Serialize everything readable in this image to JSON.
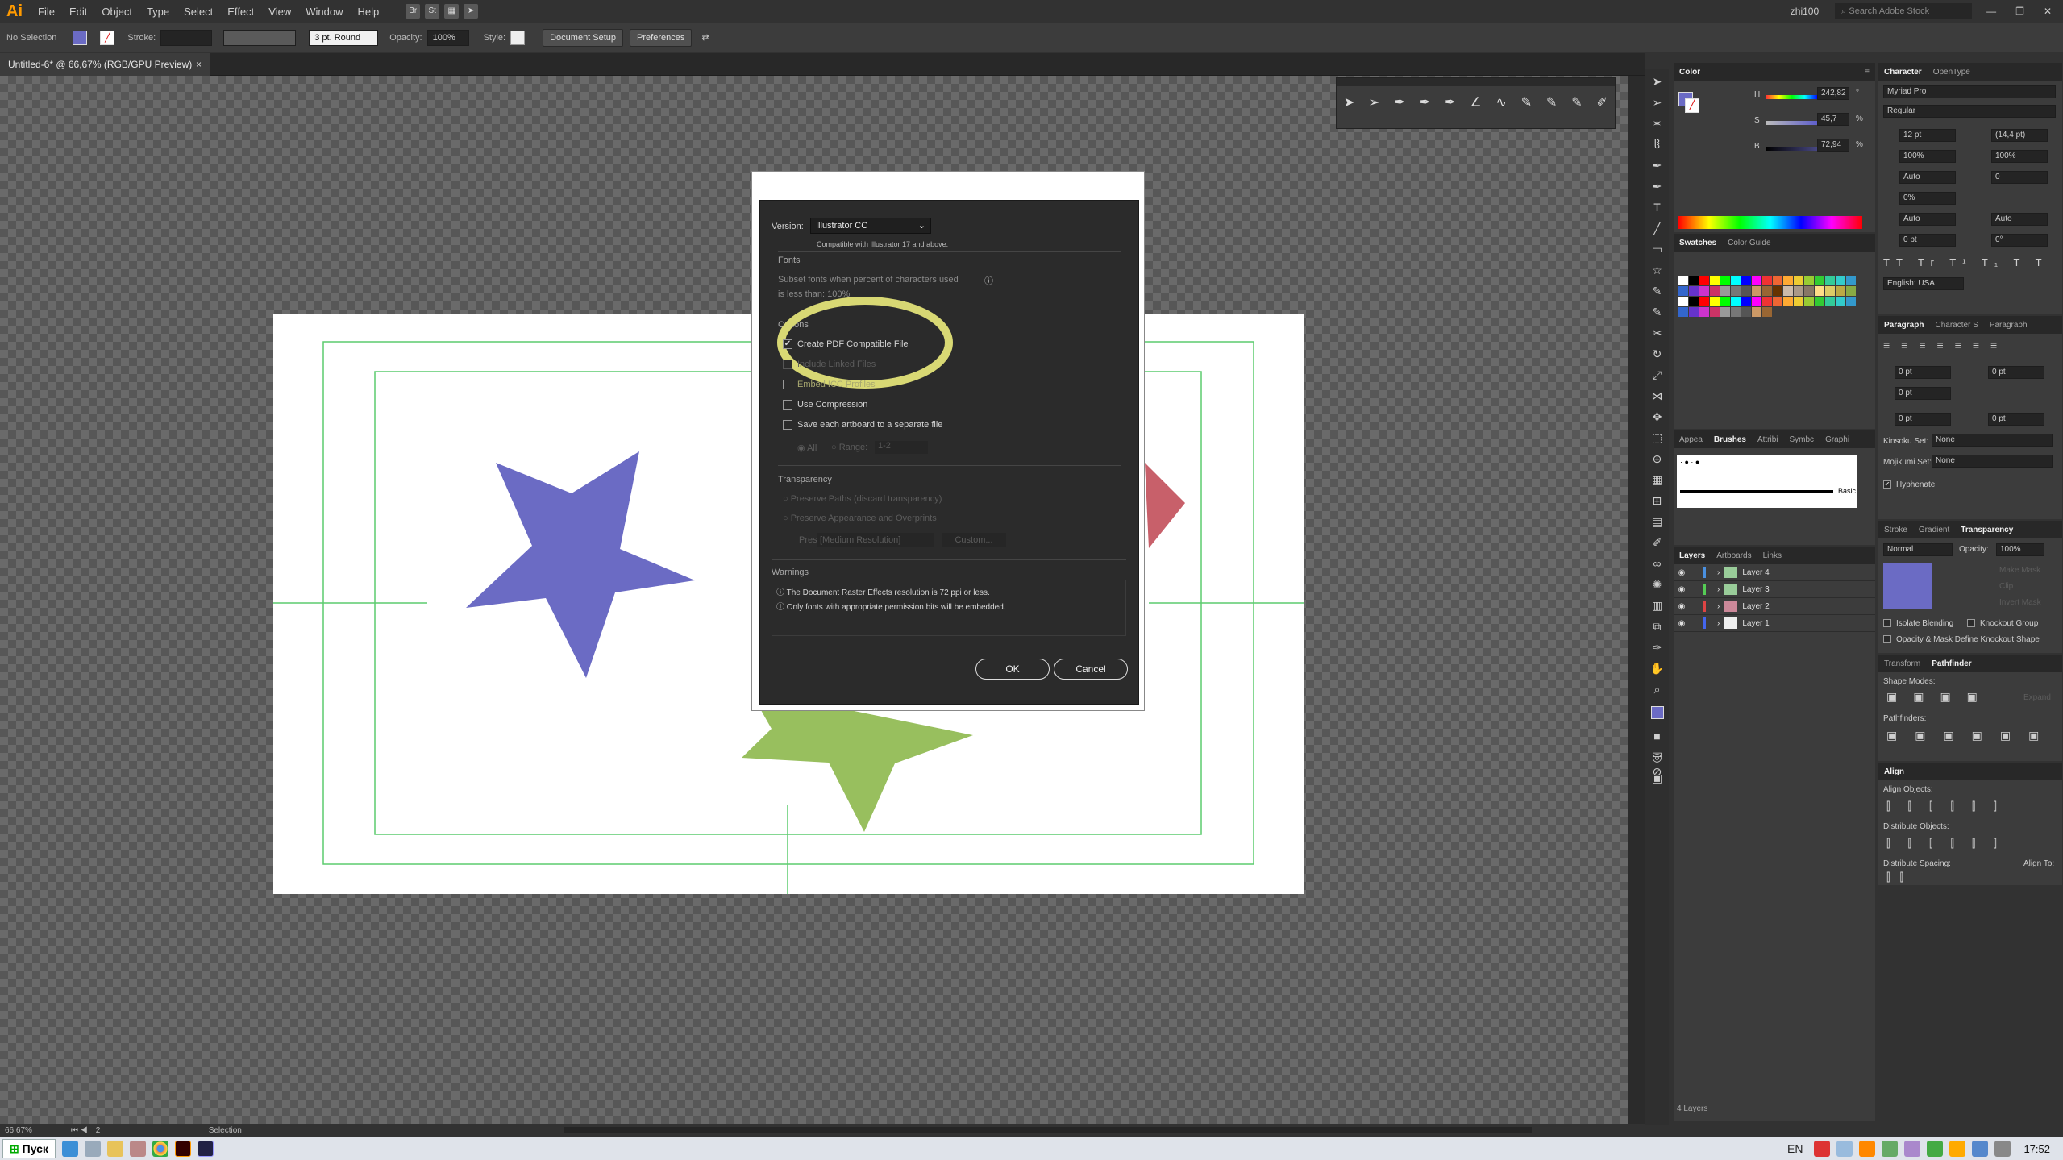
{
  "menubar": {
    "logo": "Ai",
    "items": [
      "File",
      "Edit",
      "Object",
      "Type",
      "Select",
      "Effect",
      "View",
      "Window",
      "Help"
    ],
    "br": "Br",
    "st": "St",
    "user": "zhi100",
    "search_placeholder": "Search Adobe Stock"
  },
  "control": {
    "selection": "No Selection",
    "stroke_label": "Stroke:",
    "brush": "3 pt. Round",
    "opacity_label": "Opacity:",
    "opacity": "100%",
    "style_label": "Style:",
    "document_setup": "Document Setup",
    "preferences": "Preferences"
  },
  "tab": {
    "title": "Untitled-6* @ 66,67% (RGB/GPU Preview)",
    "close": "×"
  },
  "status": {
    "zoom": "66,67%",
    "artboard": "2",
    "tool": "Selection"
  },
  "dialog": {
    "version_label": "Version:",
    "version": "Illustrator CC",
    "compat": "Compatible with Illustrator 17 and above.",
    "fonts_title": "Fonts",
    "subset": "Subset fonts when percent of characters used",
    "subset_value": "is less than: 100%",
    "options_title": "Options",
    "opt_pdf": "Create PDF Compatible File",
    "opt_linked": "Include Linked Files",
    "opt_icc": "Embed ICC Profiles",
    "opt_compress": "Use Compression",
    "opt_artboards": "Save each artboard to a separate file",
    "all": "All",
    "range": "Range:",
    "range_value": "1-2",
    "transp_title": "Transparency",
    "tr1": "Preserve Paths (discard transparency)",
    "tr2": "Preserve Appearance and Overprints",
    "preset": "Preset:",
    "preset_value": "[Medium Resolution]",
    "custom": "Custom...",
    "warnings_title": "Warnings",
    "warn1": "The Document Raster Effects resolution is 72 ppi or less.",
    "warn2": "Only fonts with appropriate permission bits will be embedded.",
    "ok": "OK",
    "cancel": "Cancel"
  },
  "panels": {
    "color": {
      "title": "Color",
      "h": "H",
      "s": "S",
      "b": "B",
      "h_val": "242,82",
      "s_val": "45,7",
      "b_val": "72,94",
      "pct": "%",
      "deg": "°"
    },
    "swatches": {
      "tab1": "Swatches",
      "tab2": "Color Guide"
    },
    "brushes": {
      "tabs": [
        "Appea",
        "Brushes",
        "Attribi",
        "Symbc",
        "Graphi"
      ],
      "basic": "Basic"
    },
    "layers": {
      "tabs": [
        "Layers",
        "Artboards",
        "Links"
      ],
      "rows": [
        "Layer 4",
        "Layer 3",
        "Layer 2",
        "Layer 1"
      ],
      "count": "4 Layers"
    },
    "character": {
      "tab1": "Character",
      "tab2": "OpenType",
      "font": "Myriad Pro",
      "style": "Regular",
      "size": "12 pt",
      "leading": "(14,4 pt)",
      "scale_v": "100%",
      "scale_h": "100%",
      "kern": "Auto",
      "track": "0",
      "shift": "0%",
      "auto1": "Auto",
      "auto2": "Auto",
      "bs": "0 pt",
      "rot": "0°",
      "lang": "English: USA"
    },
    "paragraph": {
      "tabs": [
        "Paragraph",
        "Character S",
        "Paragraph"
      ],
      "zero": "0 pt",
      "kinsoku": "Kinsoku Set:",
      "mojikumi": "Mojikumi Set:",
      "none": "None",
      "hyphenate": "Hyphenate"
    },
    "transparency": {
      "tabs": [
        "Stroke",
        "Gradient",
        "Transparency"
      ],
      "mode": "Normal",
      "opacity_label": "Opacity:",
      "opacity": "100%",
      "make_mask": "Make Mask",
      "clip": "Clip",
      "invert": "Invert Mask",
      "isolate": "Isolate Blending",
      "knockout": "Knockout Group",
      "opacity_mask": "Opacity & Mask Define Knockout Shape"
    },
    "pathfinder": {
      "tabs": [
        "Transform",
        "Pathfinder"
      ],
      "shape_modes": "Shape Modes:",
      "expand": "Expand",
      "pathfinders": "Pathfinders:"
    },
    "align": {
      "title": "Align",
      "objects": "Align Objects:",
      "distribute": "Distribute Objects:",
      "spacing": "Distribute Spacing:",
      "align_to": "Align To:"
    }
  },
  "taskbar": {
    "start": "Пуск",
    "lang": "EN",
    "time": "17:52"
  },
  "colors": {
    "star_blue": "#6b6bc4",
    "star_green": "#98bf5e",
    "star_red": "#c8606a",
    "guide": "#5ccc6e",
    "highlight": "#d8d874"
  }
}
